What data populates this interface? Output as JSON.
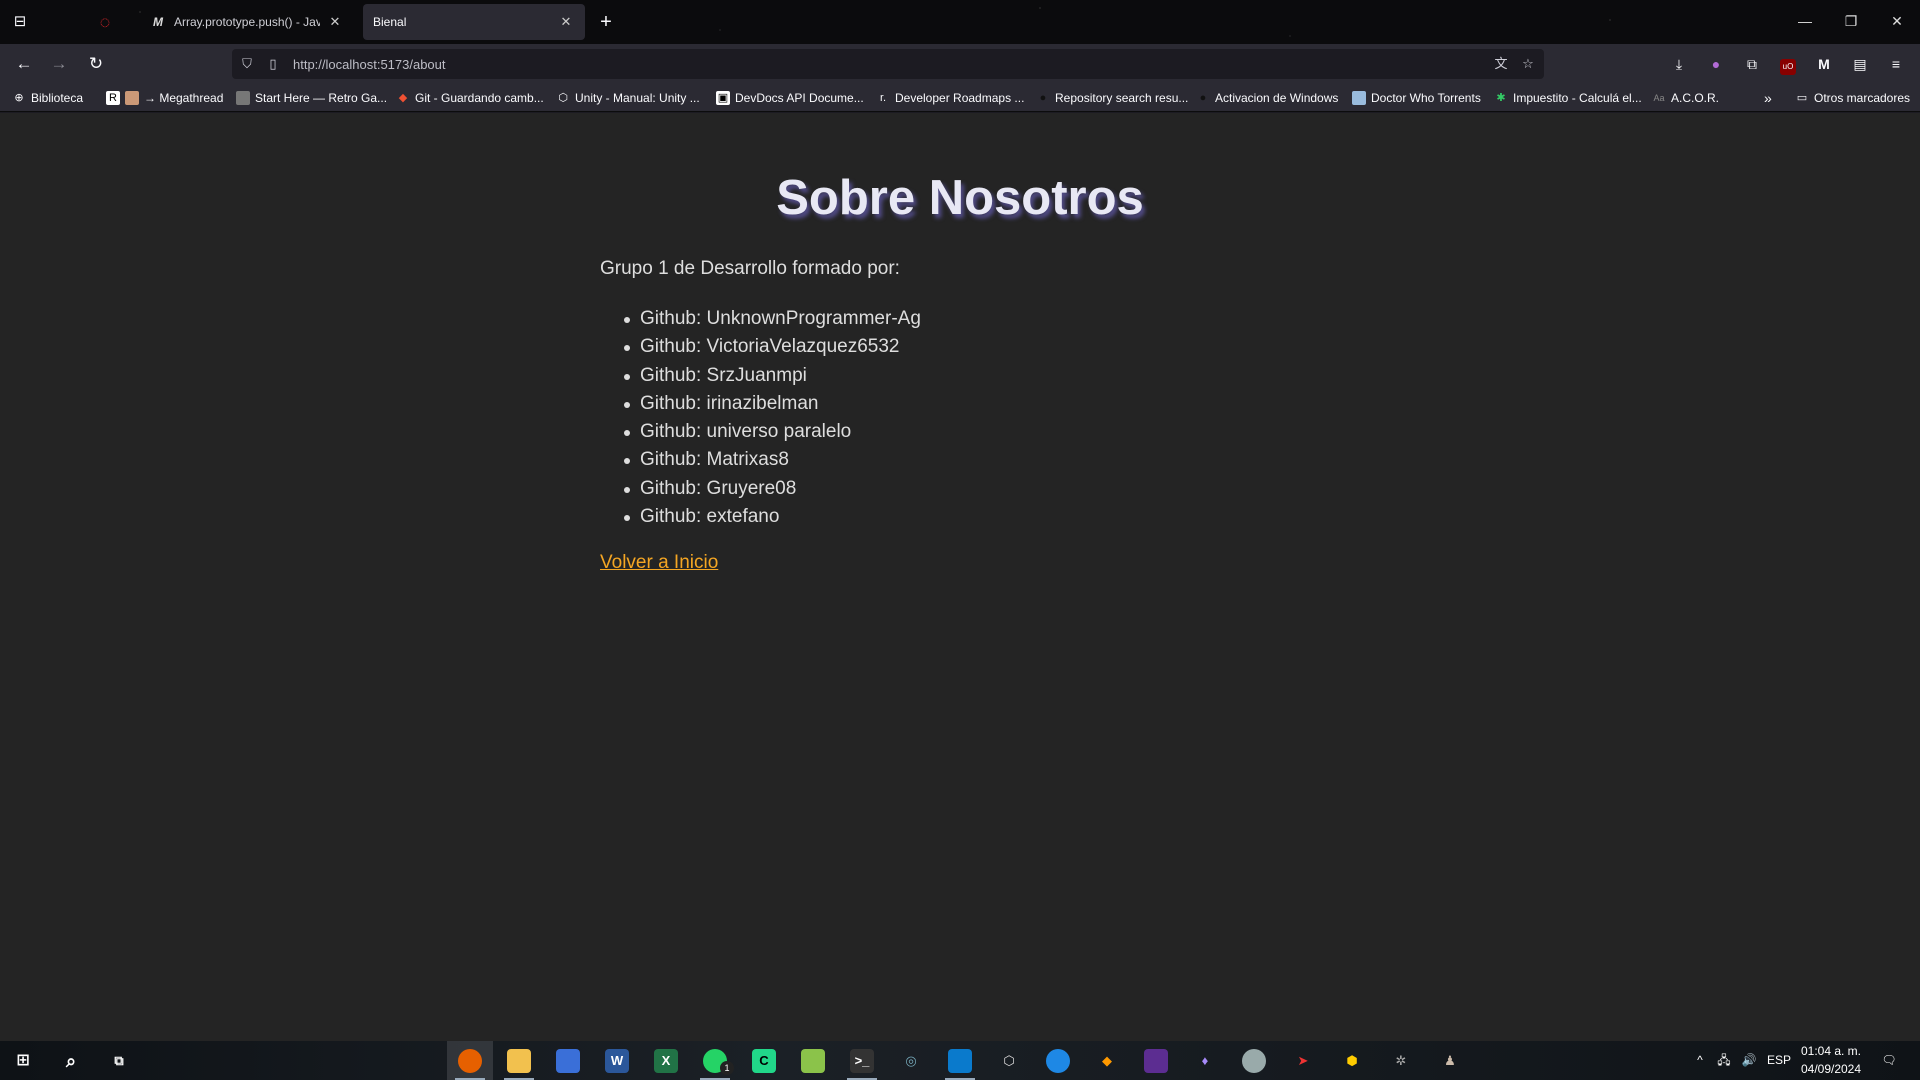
{
  "browser": {
    "tabs": [
      {
        "label": "Array.prototype.push() - JavaSc",
        "icon": "M"
      },
      {
        "label": "Bienal",
        "icon": ""
      }
    ],
    "url": "http://localhost:5173/about",
    "bookmarks": [
      "Biblioteca",
      "→ Megathread",
      "Start Here — Retro Ga...",
      "Git - Guardando camb...",
      "Unity - Manual: Unity ...",
      "DevDocs API Docume...",
      "Developer Roadmaps ...",
      "Repository search resu...",
      "Activacion de Windows",
      "Doctor Who Torrents",
      "Impuestito - Calculá el...",
      "A.C.O.R."
    ],
    "other_bookmarks": "Otros marcadores"
  },
  "page": {
    "title": "Sobre Nosotros",
    "intro": "Grupo 1 de Desarrollo formado por:",
    "members": [
      "Github: UnknownProgrammer-Ag",
      "Github: VictoriaVelazquez6532",
      "Github: SrzJuanmpi",
      "Github: irinazibelman",
      "Github: universo paralelo",
      "Github: Matrixas8",
      "Github: Gruyere08",
      "Github: extefano"
    ],
    "back_link": "Volver a Inicio"
  },
  "taskbar": {
    "language": "ESP",
    "time": "01:04 a. m.",
    "date": "04/09/2024",
    "whatsapp_badge": "1"
  },
  "colors": {
    "accent_link": "#f5a623",
    "page_bg": "#242424",
    "chrome_bg": "#2b2a33"
  }
}
